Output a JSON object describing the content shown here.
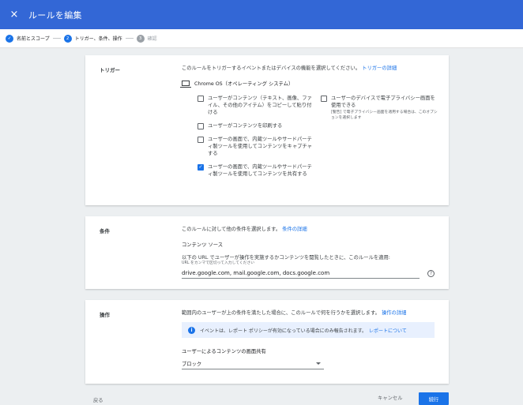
{
  "app": {
    "title": "ルールを編集",
    "close_icon": "×"
  },
  "stepper": {
    "steps": [
      {
        "index": "✓",
        "label": "名前とスコープ",
        "state": "done"
      },
      {
        "index": "2",
        "label": "トリガー、条件、操作",
        "state": "active"
      },
      {
        "index": "3",
        "label": "確認",
        "state": "pending"
      }
    ]
  },
  "trigger": {
    "title": "トリガー",
    "description": "このルールをトリガーするイベントまたはデバイスの機能を選択してください。",
    "link": "トリガーの詳細",
    "os_label": "Chrome OS（オペレーティング システム）",
    "options": [
      {
        "label": "ユーザーがコンテンツ（テキスト、画像、ファイル、その他のアイテム）をコピーして貼り付ける",
        "checked": false
      },
      {
        "label": "ユーザーがコンテンツを印刷する",
        "checked": false
      },
      {
        "label": "ユーザーの画面で、内蔵ツールやサードパーティ製ツールを使用してコンテンツをキャプチャする",
        "checked": false
      },
      {
        "label": "ユーザーの画面で、内蔵ツールやサードパーティ製ツールを使用してコンテンツを共有する",
        "checked": true
      }
    ],
    "privacy_option": {
      "label": "ユーザーのデバイスで電子プライバシー画面を使用できる",
      "note": "[警告] で電子プライバシー画面を適用する場合は、このオプションを選択します",
      "checked": false
    }
  },
  "condition": {
    "title": "条件",
    "description": "このルールに対して他の条件を選択します。",
    "link": "条件の詳細",
    "source_label": "コンテンツ ソース",
    "url_description": "以下の URL でユーザーが操作を実施するかコンテンツを閲覧したときに、このルールを適用:",
    "url_hint": "URL をカンマで区切って入力してください",
    "url_value": "drive.google.com, mail.google.com, docs.google.com",
    "help_icon": "?"
  },
  "action": {
    "title": "操作",
    "description": "範囲内のユーザーが上の条件を満たした場合に、このルールで何を行うかを選択します。",
    "link": "操作の詳細",
    "info_icon": "i",
    "info_text": "イベントは、レポート ポリシーが有効になっている場合にのみ報告されます。",
    "info_link": "レポートについて",
    "share_label": "ユーザーによるコンテンツの画面共有",
    "share_value": "ブロック"
  },
  "footer": {
    "back": "戻る",
    "cancel": "キャンセル",
    "continue": "続行"
  },
  "colors": {
    "header": "#3367d6",
    "accent": "#1a73e8",
    "background": "#eceff1"
  }
}
